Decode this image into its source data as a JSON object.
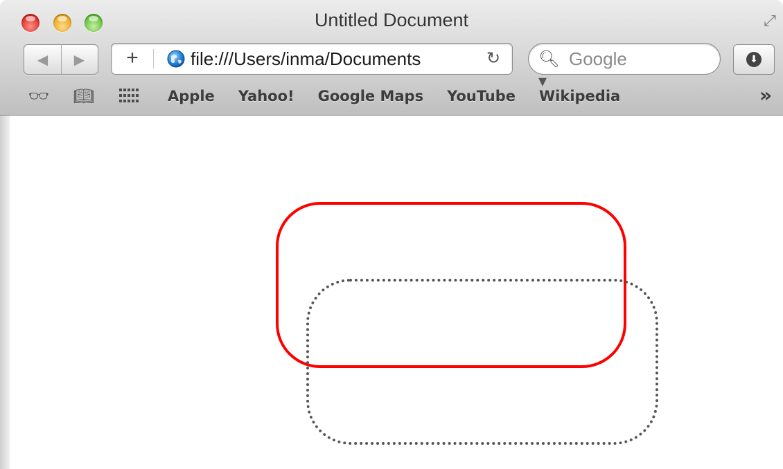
{
  "window": {
    "title": "Untitled Document"
  },
  "toolbar": {
    "add_tab_label": "+",
    "url": "file:///Users/inma/Documents",
    "reload_icon": "reload-icon",
    "search_placeholder": "Google",
    "search_icon": "search-icon"
  },
  "bookmarks": {
    "items": [
      {
        "label": "Apple"
      },
      {
        "label": "Yahoo!"
      },
      {
        "label": "Google Maps"
      },
      {
        "label": "YouTube"
      },
      {
        "label": "Wikipedia"
      }
    ]
  },
  "page": {
    "shapes": [
      {
        "name": "solid-rounded-box",
        "border_style": "solid",
        "color": "#ff0000"
      },
      {
        "name": "dotted-rounded-box",
        "border_style": "dotted",
        "color": "#555555"
      }
    ]
  }
}
